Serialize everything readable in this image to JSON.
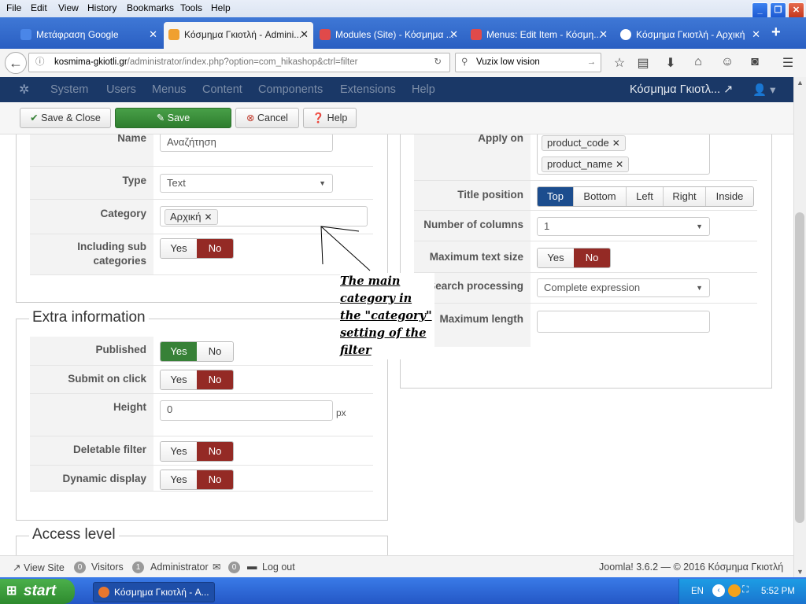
{
  "menubar": {
    "items": [
      "File",
      "Edit",
      "View",
      "History",
      "Bookmarks",
      "Tools",
      "Help"
    ]
  },
  "tabs": [
    {
      "label": "Μετάφραση Google"
    },
    {
      "label": "Κόσμημα Γκιοτλή - Admini..."
    },
    {
      "label": "Modules (Site) - Κόσμημα ..."
    },
    {
      "label": "Menus: Edit Item - Κόσμη..."
    },
    {
      "label": "Κόσμημα Γκιοτλή - Αρχική"
    }
  ],
  "nav": {
    "url_domain": "kosmima-gkiotli.gr",
    "url_path": "/administrator/index.php?option=com_hikashop&ctrl=filter",
    "search_value": "Vuzix low vision"
  },
  "joomla_nav": {
    "items": [
      "System",
      "Users",
      "Menus",
      "Content",
      "Components",
      "Extensions",
      "Help"
    ],
    "site_name": "Κόσμημα Γκιοτλ..."
  },
  "toolbar": {
    "save_close": "Save & Close",
    "save": "Save",
    "cancel": "Cancel",
    "help": "Help"
  },
  "form": {
    "name_label": "Name",
    "name_value": "Αναζήτηση",
    "type_label": "Type",
    "type_value": "Text",
    "category_label": "Category",
    "category_tag": "Αρχική",
    "sub_label_1": "Including sub",
    "sub_label_2": "categories",
    "yes": "Yes",
    "no": "No"
  },
  "extra": {
    "title": "Extra information",
    "published": "Published",
    "submit_on_click": "Submit on click",
    "height": "Height",
    "height_value": "0",
    "height_unit": "px",
    "deletable": "Deletable filter",
    "dynamic": "Dynamic display"
  },
  "access": {
    "title": "Access level"
  },
  "right": {
    "apply_on": "Apply on",
    "apply_tags": [
      "product_code",
      "product_name"
    ],
    "title_position": "Title position",
    "positions": [
      "Top",
      "Bottom",
      "Left",
      "Right",
      "Inside"
    ],
    "num_columns": "Number of columns",
    "num_columns_value": "1",
    "max_text": "Maximum text size",
    "search_processing": "Search processing",
    "search_processing_value": "Complete expression",
    "max_length": "Maximum length"
  },
  "note": "The main category in the \"category\" setting of the filter",
  "status": {
    "view_site": "View Site",
    "visitors_count": "0",
    "visitors": "Visitors",
    "admin_count": "1",
    "admin": "Administrator",
    "msg_count": "0",
    "logout": "Log out",
    "version": "Joomla! 3.6.2 — © 2016 Κόσμημα Γκιοτλή"
  },
  "taskbar": {
    "start": "start",
    "item": "Κόσμημα Γκιοτλή - A...",
    "lang": "EN",
    "time": "5:52 PM"
  },
  "colors": {
    "joomla_nav": "#1a3867",
    "save_green": "#378137",
    "no_red": "#942a25",
    "active_blue": "#1c4d8e"
  }
}
